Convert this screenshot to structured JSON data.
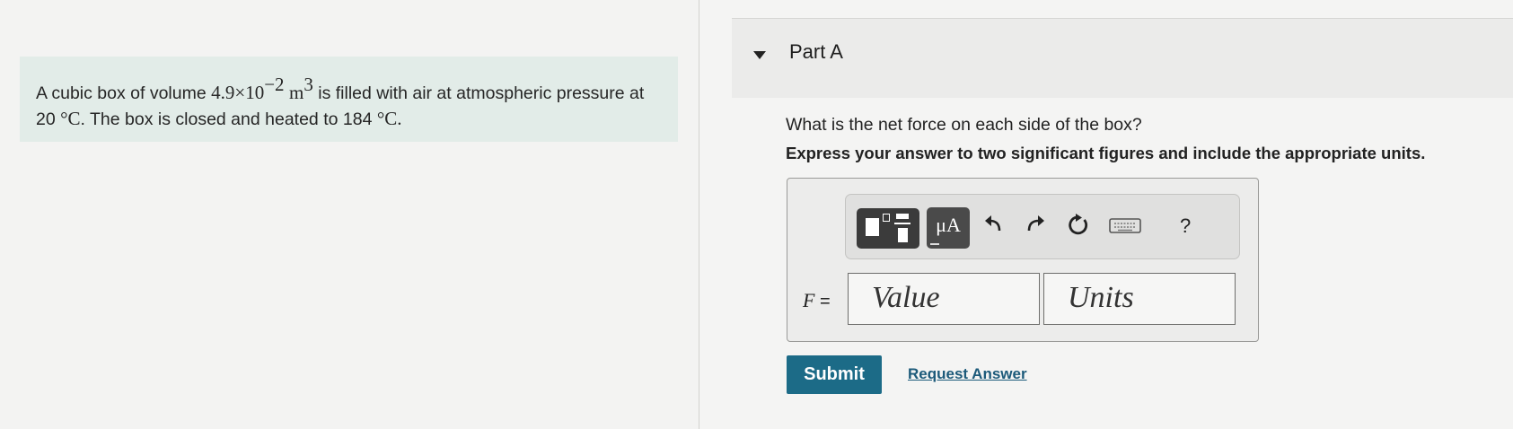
{
  "problem": {
    "intro": "A cubic box of volume ",
    "volume_mantissa": "4.9×10",
    "volume_exponent": "−2",
    "volume_unit": "m",
    "volume_unit_exponent": "3",
    "mid": " is filled with air at atmospheric pressure at ",
    "initial_temp": "20",
    "temp_unit": "°C",
    "mid2": ". The box is closed and heated to ",
    "final_temp": "184",
    "end": "."
  },
  "part": {
    "title": "Part A",
    "question": "What is the net force on each side of the box?",
    "instruction": "Express your answer to two significant figures and include the appropriate units."
  },
  "toolbar": {
    "units_button_label": "μA",
    "help_label": "?",
    "icons": [
      "templates-icon",
      "units-icon",
      "undo-icon",
      "redo-icon",
      "reset-icon",
      "keyboard-icon",
      "help-icon"
    ]
  },
  "answer": {
    "variable": "F",
    "equals": " =",
    "value_placeholder": "Value",
    "units_placeholder": "Units"
  },
  "actions": {
    "submit_label": "Submit",
    "request_answer_label": "Request Answer"
  },
  "colors": {
    "problem_background": "#e2ece8",
    "submit_background": "#1c6b87",
    "link": "#1c5a7a"
  }
}
